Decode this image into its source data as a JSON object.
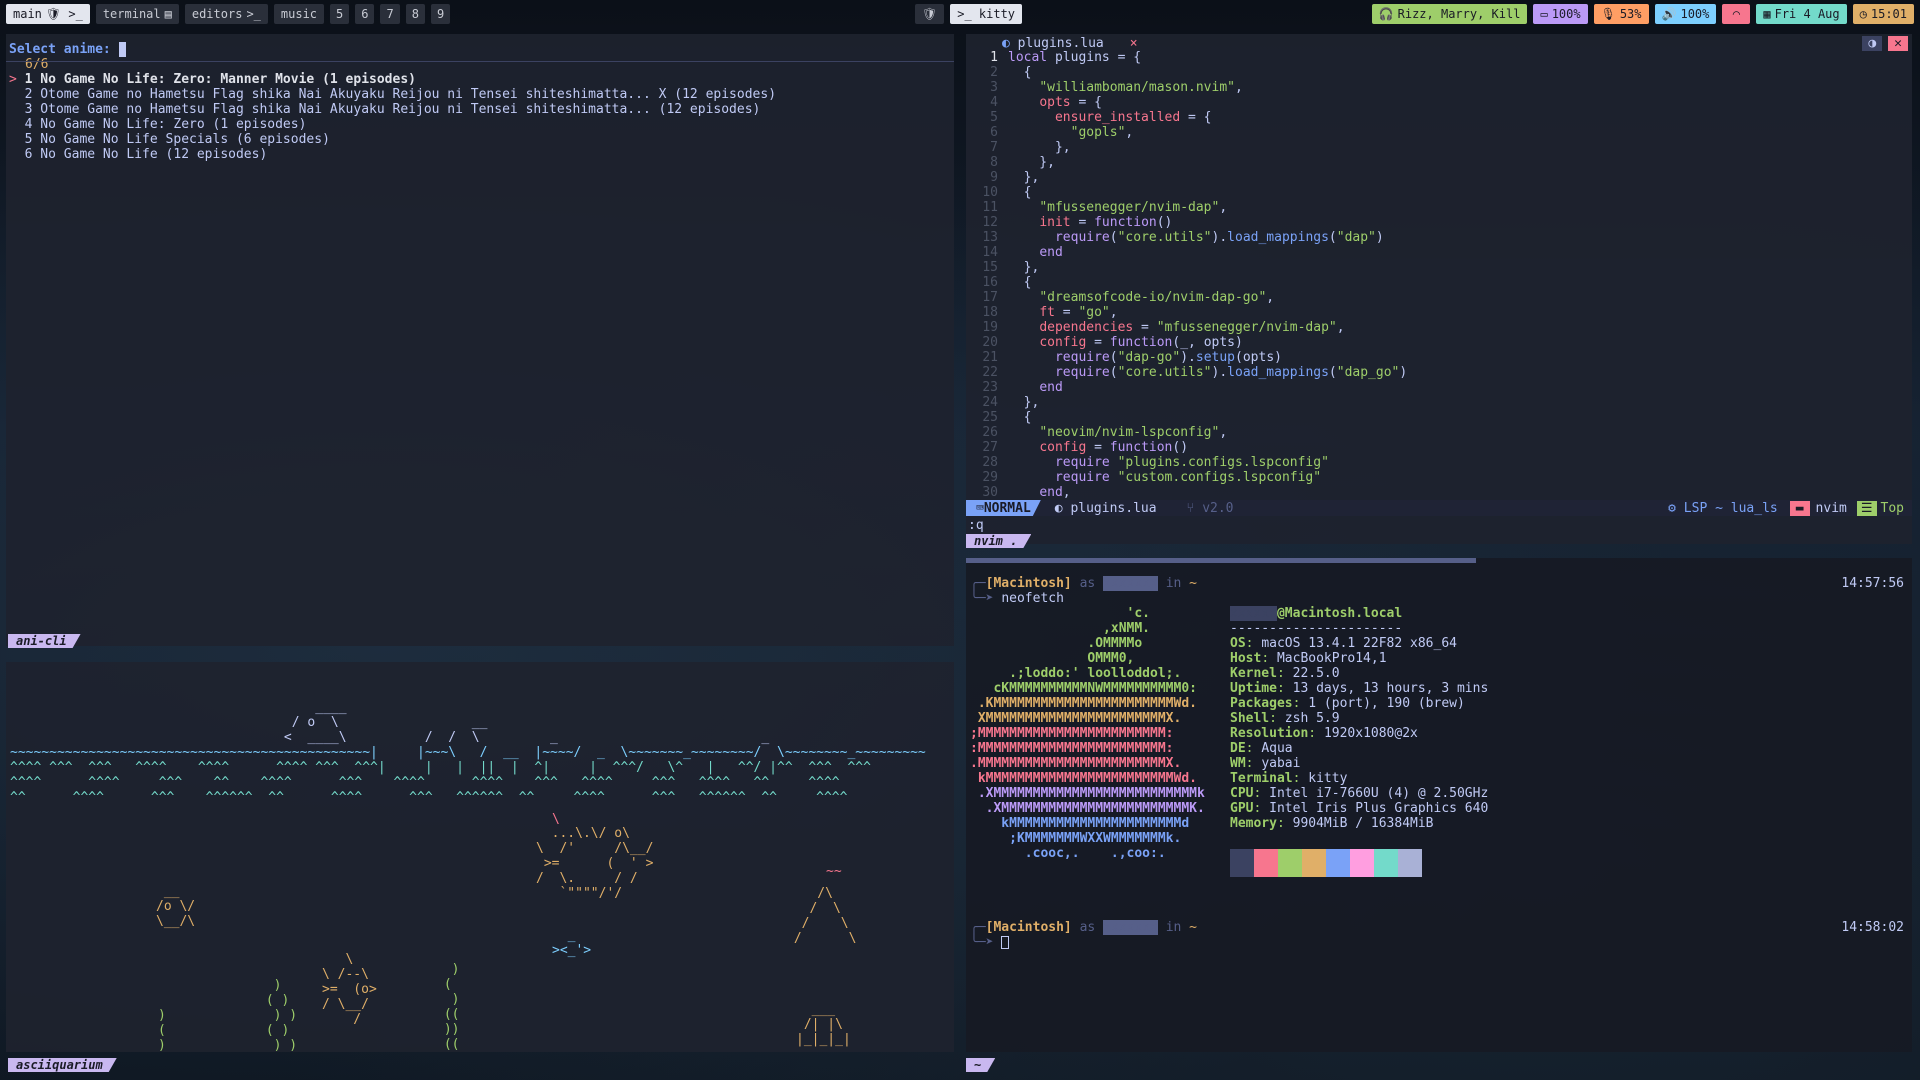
{
  "topbar": {
    "workspaces": [
      {
        "label": "main",
        "icons": "🛡 >_",
        "active": true
      },
      {
        "label": "terminal",
        "icons": "▤",
        "active": false
      },
      {
        "label": "editors",
        "icons": ">_",
        "active": false
      },
      {
        "label": "music",
        "icons": "",
        "active": false
      }
    ],
    "numbered": [
      "5",
      "6",
      "7",
      "8",
      "9"
    ],
    "center_icon": "🛡",
    "center_app": ">_ kitty",
    "status": {
      "bluetooth": "Rizz, Marry, Kill",
      "battery": "100%",
      "mic": "53%",
      "volume": "100%",
      "date": "Fri 4 Aug",
      "time": "15:01"
    },
    "colors": {
      "bluetooth": "#9ece6a",
      "battery": "#bb9af7",
      "mic": "#ff9e64",
      "volume": "#7dcfff",
      "wifi": "#f7768e",
      "date": "#73daca",
      "time": "#e0af68"
    }
  },
  "anicli": {
    "prompt": "Select anime:",
    "count": "6/6",
    "items": [
      "1 No Game No Life: Zero: Manner Movie (1 episodes)",
      "2 Otome Game no Hametsu Flag shika Nai Akuyaku Reijou ni Tensei shiteshimatta... X (12 episodes)",
      "3 Otome Game no Hametsu Flag shika Nai Akuyaku Reijou ni Tensei shiteshimatta... (12 episodes)",
      "4 No Game No Life: Zero (1 episodes)",
      "5 No Game No Life Specials (6 episodes)",
      "6 No Game No Life (12 episodes)"
    ],
    "selected_marker": ">",
    "label": "ani-cli"
  },
  "nvim": {
    "tab_file": "plugins.lua",
    "tab_close": "×",
    "lines": [
      "local plugins = {",
      "  {",
      "    \"williamboman/mason.nvim\",",
      "    opts = {",
      "      ensure_installed = {",
      "        \"gopls\",",
      "      },",
      "    },",
      "  },",
      "  {",
      "    \"mfussenegger/nvim-dap\",",
      "    init = function()",
      "      require(\"core.utils\").load_mappings(\"dap\")",
      "    end",
      "  },",
      "  {",
      "    \"dreamsofcode-io/nvim-dap-go\",",
      "    ft = \"go\",",
      "    dependencies = \"mfussenegger/nvim-dap\",",
      "    config = function(_, opts)",
      "      require(\"dap-go\").setup(opts)",
      "      require(\"core.utils\").load_mappings(\"dap_go\")",
      "    end",
      "  },",
      "  {",
      "    \"neovim/nvim-lspconfig\",",
      "    config = function()",
      "      require \"plugins.configs.lspconfig\"",
      "      require \"custom.configs.lspconfig\"",
      "    end,"
    ],
    "status_mode": "NORMAL",
    "status_file": "plugins.lua",
    "status_branch": "v2.0",
    "status_lsp": "LSP ~ lua_ls",
    "status_app": "nvim",
    "status_pos": "Top",
    "cmdline": ":q",
    "label": "nvim ."
  },
  "neofetch": {
    "prompt1_host": "[Macintosh]",
    "prompt_as": "as",
    "prompt_in": "in ~",
    "prompt1_time": "14:57:56",
    "command": "neofetch",
    "user_host": "@Macintosh.local",
    "separator": "----------------------",
    "info": [
      {
        "k": "OS",
        "v": "macOS 13.4.1 22F82 x86_64"
      },
      {
        "k": "Host",
        "v": "MacBookPro14,1"
      },
      {
        "k": "Kernel",
        "v": "22.5.0"
      },
      {
        "k": "Uptime",
        "v": "13 days, 13 hours, 3 mins"
      },
      {
        "k": "Packages",
        "v": "1 (port), 190 (brew)"
      },
      {
        "k": "Shell",
        "v": "zsh 5.9"
      },
      {
        "k": "Resolution",
        "v": "1920x1080@2x"
      },
      {
        "k": "DE",
        "v": "Aqua"
      },
      {
        "k": "WM",
        "v": "yabai"
      },
      {
        "k": "Terminal",
        "v": "kitty"
      },
      {
        "k": "CPU",
        "v": "Intel i7-7660U (4) @ 2.50GHz"
      },
      {
        "k": "GPU",
        "v": "Intel Iris Plus Graphics 640"
      },
      {
        "k": "Memory",
        "v": "9904MiB / 16384MiB"
      }
    ],
    "logo": [
      "                    'c.",
      "                 ,xNMM.",
      "               .OMMMMo",
      "               OMMM0,",
      "     .;loddo:' loolloddol;.",
      "   cKMMMMMMMMMMNWMMMMMMMMMM0:",
      " .KMMMMMMMMMMMMMMMMMMMMMMMWd.",
      " XMMMMMMMMMMMMMMMMMMMMMMMX.",
      ";MMMMMMMMMMMMMMMMMMMMMMMM:",
      ":MMMMMMMMMMMMMMMMMMMMMMMM:",
      ".MMMMMMMMMMMMMMMMMMMMMMMMX.",
      " kMMMMMMMMMMMMMMMMMMMMMMMMWd.",
      " .XMMMMMMMMMMMMMMMMMMMMMMMMMMk",
      "  .XMMMMMMMMMMMMMMMMMMMMMMMMK.",
      "    kMMMMMMMMMMMMMMMMMMMMMMd",
      "     ;KMMMMMMMWXXWMMMMMMMk.",
      "       .cooc,.    .,coo:."
    ],
    "logo_colors": [
      "#9ece6a",
      "#9ece6a",
      "#9ece6a",
      "#9ece6a",
      "#9ece6a",
      "#9ece6a",
      "#e0af68",
      "#e0af68",
      "#f7768e",
      "#f7768e",
      "#f7768e",
      "#f7768e",
      "#bb9af7",
      "#bb9af7",
      "#7aa2f7",
      "#7aa2f7",
      "#7aa2f7"
    ],
    "swatches": [
      "#3b4261",
      "#f7768e",
      "#9ece6a",
      "#e0af68",
      "#7aa2f7",
      "#ff9ee0",
      "#73daca",
      "#a9b1d6"
    ],
    "prompt2_time": "14:58:02",
    "label": "~"
  },
  "aquarium": {
    "label": "asciiquarium",
    "art": [
      {
        "t": "                                       ____",
        "c": "#c0caf5"
      },
      {
        "t": "                                    / o  \\                 __",
        "c": "#c0caf5"
      },
      {
        "t": "                                   <  ____\\          /  /  \\         _                          _",
        "c": "#c0caf5"
      },
      {
        "t": "~~~~~~~~~~~~~~~~~~~~~~~~~~~~~~~~~~~~~~~~~~~~~~|     |~~~\\   /  __  |~~~~/  _  \\~~~~~~~_~~~~~~~~/  \\~~~~~~~~_~~~~~~~~~",
        "c": "#7dcfff"
      },
      {
        "t": "^^^^ ^^^  ^^^   ^^^^    ^^^^      ^^^^ ^^^  ^^^|     |   |  ||  |  ^|     |  ^^^/   \\^   |   ^^/ |^^  ^^^  ^^^",
        "c": "#73daca"
      },
      {
        "t": "^^^^      ^^^^     ^^^    ^^    ^^^^      ^^^    ^^^^      ^^^^    ^^^   ^^^^     ^^^   ^^^^   ^^     ^^^^",
        "c": "#73daca"
      },
      {
        "t": "^^      ^^^^      ^^^    ^^^^^^  ^^      ^^^^      ^^^   ^^^^^^  ^^     ^^^^      ^^^   ^^^^^^  ^^     ^^^^",
        "c": "#73daca"
      }
    ]
  }
}
